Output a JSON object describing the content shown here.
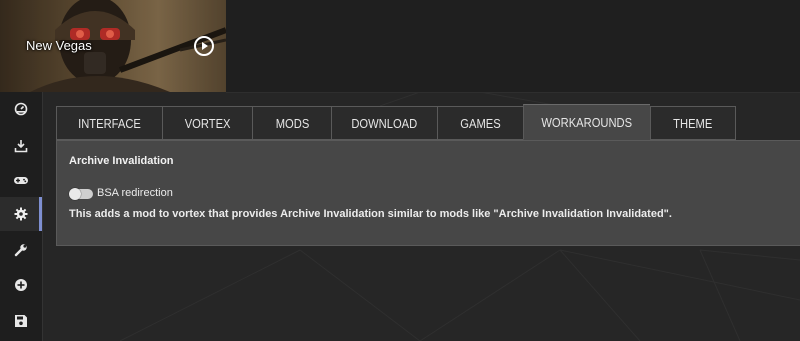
{
  "game": {
    "title": "New Vegas",
    "play_icon": "play-circle-icon"
  },
  "sidebar": {
    "items": [
      {
        "icon": "dashboard-icon",
        "active": false
      },
      {
        "icon": "download-icon",
        "active": false
      },
      {
        "icon": "gamepad-icon",
        "active": false
      },
      {
        "icon": "gear-icon",
        "active": true
      },
      {
        "icon": "wrench-icon",
        "active": false
      },
      {
        "icon": "add-circle-icon",
        "active": false
      },
      {
        "icon": "save-icon",
        "active": false
      }
    ]
  },
  "tabs": [
    {
      "label": "INTERFACE",
      "active": false
    },
    {
      "label": "VORTEX",
      "active": false
    },
    {
      "label": "MODS",
      "active": false
    },
    {
      "label": "DOWNLOAD",
      "active": false
    },
    {
      "label": "GAMES",
      "active": false
    },
    {
      "label": "WORKAROUNDS",
      "active": true
    },
    {
      "label": "THEME",
      "active": false
    }
  ],
  "panel": {
    "section_title": "Archive Invalidation",
    "toggle_label": "BSA redirection",
    "toggle_on": false,
    "description": "This adds a mod to vortex that provides Archive Invalidation similar to mods like \"Archive Invalidation Invalidated\"."
  },
  "colors": {
    "accent": "#7e8fd1",
    "panel_bg": "#474747",
    "app_bg": "#262626"
  }
}
